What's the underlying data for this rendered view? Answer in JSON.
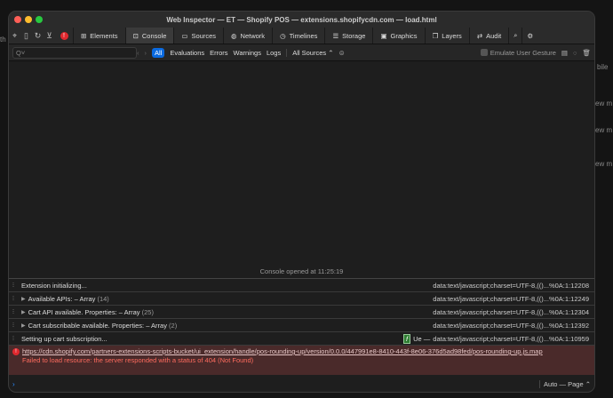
{
  "background": {
    "left_fragment": "th",
    "right_fragments": [
      "bile",
      "ew m",
      "ew m",
      "ew m"
    ]
  },
  "window": {
    "title": "Web Inspector — ET — Shopify POS — extensions.shopifycdn.com — load.html"
  },
  "tabs": [
    {
      "label": "Elements",
      "icon": "elements-icon"
    },
    {
      "label": "Console",
      "icon": "console-icon"
    },
    {
      "label": "Sources",
      "icon": "document-icon"
    },
    {
      "label": "Network",
      "icon": "network-icon"
    },
    {
      "label": "Timelines",
      "icon": "clock-icon"
    },
    {
      "label": "Storage",
      "icon": "database-icon"
    },
    {
      "label": "Graphics",
      "icon": "image-icon"
    },
    {
      "label": "Layers",
      "icon": "layers-icon"
    },
    {
      "label": "Audit",
      "icon": "audit-icon"
    }
  ],
  "filter": {
    "search_placeholder": "Q˅",
    "buttons": [
      "All",
      "Evaluations",
      "Errors",
      "Warnings",
      "Logs"
    ],
    "sources": "All Sources ⌃",
    "emulate": "Emulate User Gesture"
  },
  "console": {
    "opened": "Console opened at 11:25:19",
    "rows": [
      {
        "text": "Extension initializing...",
        "count": "",
        "expand": false,
        "source": "data:text/javascript;charset=UTF-8,(()...%0A:1:12208"
      },
      {
        "text": "Available APIs: – Array",
        "count": "(14)",
        "expand": true,
        "source": "data:text/javascript;charset=UTF-8,(()...%0A:1:12249"
      },
      {
        "text": "Cart API available. Properties: – Array",
        "count": "(25)",
        "expand": true,
        "source": "data:text/javascript;charset=UTF-8,(()...%0A:1:12304"
      },
      {
        "text": "Cart subscribable available. Properties: – Array",
        "count": "(2)",
        "expand": true,
        "source": "data:text/javascript;charset=UTF-8,(()...%0A:1:12392"
      },
      {
        "text": "Setting up cart subscription...",
        "count": "",
        "expand": false,
        "fn": "f",
        "fn_name": "Ue —",
        "source": "data:text/javascript;charset=UTF-8,(()...%0A:1:10959"
      }
    ],
    "error": {
      "url": "https://cdn.shopify.com/partners-extensions-scripts-bucket/ui_extension/handle/pos-rounding-up/version/0.0.0/447991e8-8410-443f-8e06-376d5ad98fed/pos-rounding-up.js.map",
      "message": "Failed to load resource: the server responded with a status of 404 (Not Found)"
    },
    "context": "Auto — Page ⌃"
  }
}
